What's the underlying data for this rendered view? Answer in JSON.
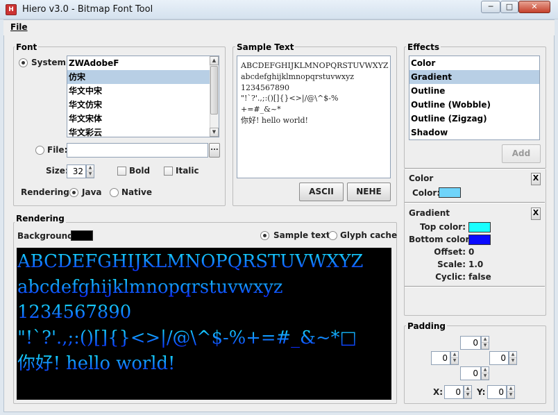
{
  "window": {
    "title": "Hiero v3.0 - Bitmap Font Tool",
    "icon": "hiero-app-icon",
    "controls": [
      "minimize-icon",
      "maximize-icon",
      "close-icon"
    ]
  },
  "menu": {
    "file": "File"
  },
  "font": {
    "group_label": "Font",
    "system_label": "System:",
    "system_fonts": [
      "ZWAdobeF",
      "仿宋",
      "华文中宋",
      "华文仿宋",
      "华文宋体",
      "华文彩云"
    ],
    "selected_index": 1,
    "file_label": "File:",
    "file_value": "",
    "browse_label": "...",
    "size_label": "Size:",
    "size_value": "32",
    "bold_label": "Bold",
    "italic_label": "Italic",
    "rendering_label": "Rendering:",
    "java_label": "Java",
    "native_label": "Native",
    "system_selected": true,
    "java_selected": true
  },
  "sample": {
    "group_label": "Sample Text",
    "lines": [
      "ABCDEFGHIJKLMNOPQRSTUVWXYZ",
      "abcdefghijklmnopqrstuvwxyz",
      "1234567890",
      "\"!`?'.,;:()[]{}<>|/@\\^$-%",
      "+=#_&~*",
      "你好! hello world!"
    ],
    "ascii_label": "ASCII",
    "nehe_label": "NEHE"
  },
  "effects": {
    "group_label": "Effects",
    "items": [
      "Color",
      "Gradient",
      "Outline",
      "Outline (Wobble)",
      "Outline (Zigzag)",
      "Shadow"
    ],
    "selected_index": 1,
    "add_label": "Add"
  },
  "color_effect": {
    "title": "Color",
    "remove_label": "X",
    "color_label": "Color:",
    "color": "#6fd4fa"
  },
  "gradient_effect": {
    "title": "Gradient",
    "remove_label": "X",
    "top_label": "Top color:",
    "top_color": "#19ffff",
    "bottom_label": "Bottom color:",
    "bottom_color": "#0a0aff",
    "offset_label": "Offset:",
    "offset_value": "0",
    "scale_label": "Scale:",
    "scale_value": "1.0",
    "cyclic_label": "Cyclic:",
    "cyclic_value": "false"
  },
  "rendering": {
    "group_label": "Rendering",
    "background_label": "Background:",
    "background_color": "#000000",
    "sample_text_label": "Sample text",
    "glyph_cache_label": "Glyph cache",
    "sample_text_selected": true,
    "preview_lines": [
      "ABCDEFGHIJKLMNOPQRSTUVWXYZ",
      "abcdefghijklmnopqrstuvwxyz",
      "1234567890",
      "\"!`?'.,;:()[]{}<>|/@\\^$-%+=#_&~*□",
      "你好! hello world!"
    ]
  },
  "padding": {
    "group_label": "Padding",
    "top": "0",
    "left": "0",
    "right": "0",
    "bottom": "0",
    "x_label": "X:",
    "x_value": "0",
    "y_label": "Y:",
    "y_value": "0"
  }
}
